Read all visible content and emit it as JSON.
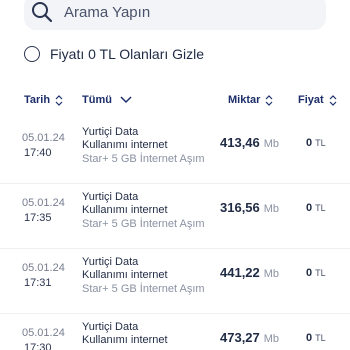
{
  "search": {
    "placeholder": "Arama Yapın"
  },
  "filter": {
    "label": "Fiyatı 0 TL Olanları Gizle",
    "checked": false
  },
  "table": {
    "headers": {
      "date": "Tarih",
      "type": "Tümü",
      "amount": "Miktar",
      "price": "Fiyat"
    },
    "rows": [
      {
        "date": "05.01.24",
        "time": "17:40",
        "provider": "Yurtiçi Data",
        "description": "Kullanımı internet",
        "package": "Star+ 5 GB İnternet Aşım",
        "amount": "413,46",
        "unit": "Mb",
        "price": "0",
        "currency": "TL"
      },
      {
        "date": "05.01.24",
        "time": "17:35",
        "provider": "Yurtiçi Data",
        "description": "Kullanımı internet",
        "package": "Star+ 5 GB İnternet Aşım",
        "amount": "316,56",
        "unit": "Mb",
        "price": "0",
        "currency": "TL"
      },
      {
        "date": "05.01.24",
        "time": "17:31",
        "provider": "Yurtiçi Data",
        "description": "Kullanımı internet",
        "package": "Star+ 5 GB İnternet Aşım",
        "amount": "441,22",
        "unit": "Mb",
        "price": "0",
        "currency": "TL"
      },
      {
        "date": "05.01.24",
        "time": "17:30",
        "provider": "Yurtiçi Data",
        "description": "Kullanımı internet",
        "package": "",
        "amount": "473,27",
        "unit": "Mb",
        "price": "0",
        "currency": "TL"
      }
    ]
  }
}
